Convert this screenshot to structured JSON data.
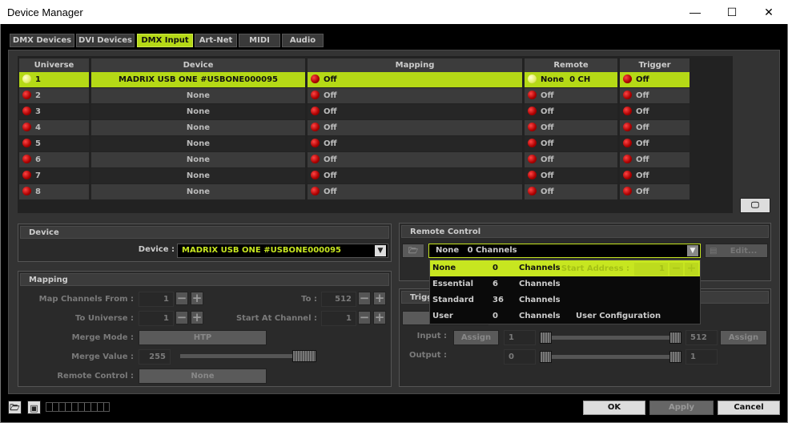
{
  "window": {
    "title": "Device Manager",
    "minimize": "—",
    "maximize": "☐",
    "close": "✕"
  },
  "tabs": [
    {
      "label": "DMX Devices"
    },
    {
      "label": "DVI Devices"
    },
    {
      "label": "DMX Input",
      "active": true
    },
    {
      "label": "Art-Net"
    },
    {
      "label": "MIDI"
    },
    {
      "label": "Audio"
    }
  ],
  "table": {
    "headers": [
      "Universe",
      "Device",
      "Mapping",
      "Remote",
      "Trigger"
    ],
    "rows": [
      {
        "universe": "1",
        "device": "MADRIX USB ONE #USBONE000095",
        "mapping": "Off",
        "remote": "None  0 CH",
        "trigger": "Off",
        "selected": true
      },
      {
        "universe": "2",
        "device": "None",
        "mapping": "Off",
        "remote": "Off",
        "trigger": "Off"
      },
      {
        "universe": "3",
        "device": "None",
        "mapping": "Off",
        "remote": "Off",
        "trigger": "Off"
      },
      {
        "universe": "4",
        "device": "None",
        "mapping": "Off",
        "remote": "Off",
        "trigger": "Off"
      },
      {
        "universe": "5",
        "device": "None",
        "mapping": "Off",
        "remote": "Off",
        "trigger": "Off"
      },
      {
        "universe": "6",
        "device": "None",
        "mapping": "Off",
        "remote": "Off",
        "trigger": "Off"
      },
      {
        "universe": "7",
        "device": "None",
        "mapping": "Off",
        "remote": "Off",
        "trigger": "Off"
      },
      {
        "universe": "8",
        "device": "None",
        "mapping": "Off",
        "remote": "Off",
        "trigger": "Off"
      }
    ]
  },
  "device_panel": {
    "title": "Device",
    "label": "Device :",
    "value": "MADRIX USB ONE #USBONE000095"
  },
  "mapping_panel": {
    "title": "Mapping",
    "map_from_label": "Map Channels From :",
    "map_from": "1",
    "to_label": "To :",
    "to": "512",
    "to_universe_label": "To Universe :",
    "to_universe": "1",
    "start_channel_label": "Start At Channel :",
    "start_channel": "1",
    "merge_mode_label": "Merge Mode :",
    "merge_mode": "HTP",
    "merge_value_label": "Merge Value :",
    "merge_value": "255",
    "remote_control_label": "Remote Control :",
    "remote_control": "None"
  },
  "remote_panel": {
    "title": "Remote Control",
    "selected": "None   0 Channels",
    "edit": "Edit...",
    "start_address_label": "Start Address :",
    "start_address": "1",
    "options": [
      {
        "name": "None",
        "count": "0",
        "unit": "Channels",
        "note": ""
      },
      {
        "name": "Essential",
        "count": "6",
        "unit": "Channels",
        "note": ""
      },
      {
        "name": "Standard",
        "count": "36",
        "unit": "Channels",
        "note": ""
      },
      {
        "name": "User",
        "count": "0",
        "unit": "Channels",
        "note": "User Configuration"
      }
    ]
  },
  "trigger_panel": {
    "title": "Trigger",
    "input_label": "Input :",
    "assign": "Assign",
    "input_min": "1",
    "input_max": "512",
    "output_label": "Output :",
    "output_min": "0",
    "output_max": "1"
  },
  "footer": {
    "ok": "OK",
    "apply": "Apply",
    "cancel": "Cancel"
  },
  "colors": {
    "accent": "#b5d916",
    "led_off": "#cc0000",
    "led_on": "#e4ee6a"
  }
}
